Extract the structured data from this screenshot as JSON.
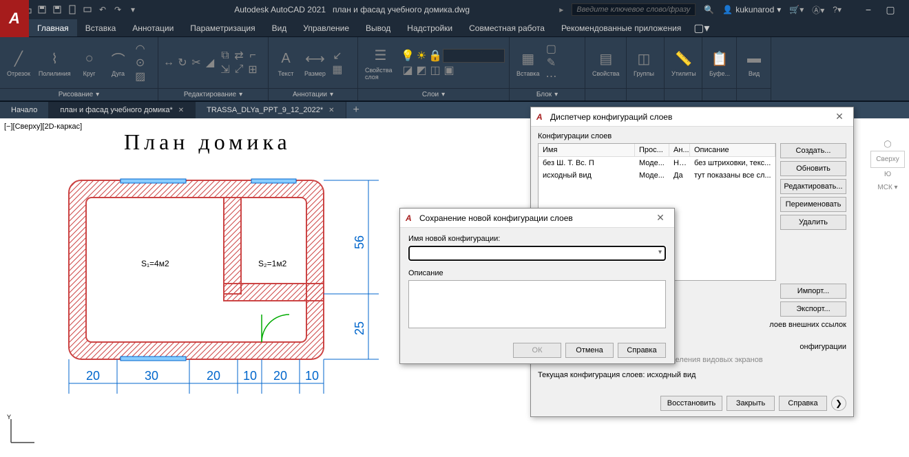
{
  "titlebar": {
    "app": "Autodesk AutoCAD 2021",
    "file": "план и фасад учебного домика.dwg",
    "search_placeholder": "Введите ключевое слово/фразу",
    "user": "kukunarod"
  },
  "ribbon_tabs": [
    "Главная",
    "Вставка",
    "Аннотации",
    "Параметризация",
    "Вид",
    "Управление",
    "Вывод",
    "Надстройки",
    "Совместная работа",
    "Рекомендованные приложения"
  ],
  "ribbon_panels": {
    "draw": {
      "label": "Рисование",
      "tools": [
        "Отрезок",
        "Полилиния",
        "Круг",
        "Дуга"
      ]
    },
    "modify": {
      "label": "Редактирование"
    },
    "annot": {
      "label": "Аннотации",
      "tools": [
        "Текст",
        "Размер"
      ]
    },
    "layers": {
      "label": "Слои",
      "tool": "Свойства слоя"
    },
    "block": {
      "label": "Блок",
      "tool": "Вставка"
    },
    "props": {
      "label": "Свойства"
    },
    "groups": {
      "label": "Группы"
    },
    "utils": {
      "label": "Утилиты"
    },
    "clip": {
      "label": "Буфе..."
    },
    "view": {
      "label": "Вид"
    }
  },
  "file_tabs": [
    {
      "label": "Начало",
      "active": false,
      "closable": false
    },
    {
      "label": "план и фасад учебного домика*",
      "active": true,
      "closable": true
    },
    {
      "label": "TRASSA_DLYa_PPT_9_12_2022*",
      "active": false,
      "closable": true
    }
  ],
  "canvas": {
    "viewport_label": "[−][Сверху][2D-каркас]",
    "drawing_title": "План домика",
    "room1": "S₁=4м2",
    "room2": "S₂=1м2",
    "dims_bottom": [
      "20",
      "30",
      "20",
      "10",
      "20",
      "10"
    ],
    "dims_right": [
      "56",
      "25"
    ]
  },
  "navcube": {
    "top": "Сверху",
    "wcs": "МСК"
  },
  "lsm": {
    "title": "Диспетчер конфигураций слоев",
    "group": "Конфигурации слоев",
    "columns": {
      "name": "Имя",
      "space": "Прос...",
      "an": "Ан...",
      "desc": "Описание"
    },
    "rows": [
      {
        "name": "без Ш. Т. Вс. П",
        "space": "Моде...",
        "an": "Нет",
        "desc": "без штриховки, текс..."
      },
      {
        "name": "исходный вид",
        "space": "Моде...",
        "an": "Да",
        "desc": "тут показаны все сл..."
      }
    ],
    "buttons": {
      "create": "Создать...",
      "update": "Обновить",
      "edit": "Редактировать...",
      "rename": "Переименовать",
      "delete": "Удалить",
      "import": "Импорт...",
      "export": "Экспорт..."
    },
    "xref_text": "лоев внешних ссылок",
    "cfg_text": "онфигурации",
    "vp_override": "Применить свойства как переопределения видовых экранов",
    "current": "Текущая конфигурация слоев: исходный вид",
    "footer": {
      "restore": "Восстановить",
      "close": "Закрыть",
      "help": "Справка"
    }
  },
  "newdlg": {
    "title": "Сохранение новой конфигурации слоев",
    "name_label": "Имя новой конфигурации:",
    "desc_label": "Описание",
    "ok": "ОК",
    "cancel": "Отмена",
    "help": "Справка"
  }
}
